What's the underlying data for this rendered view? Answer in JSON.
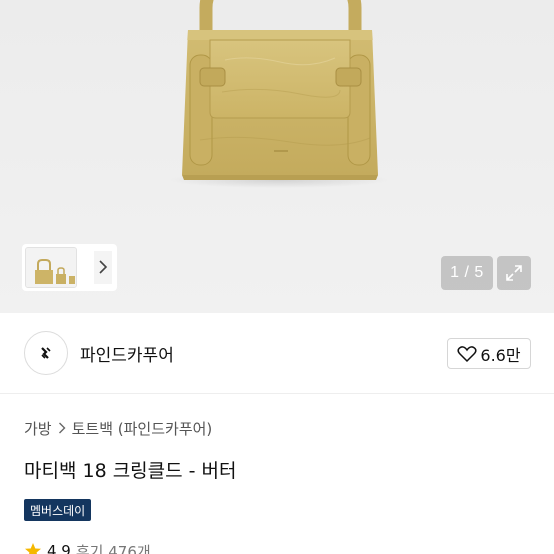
{
  "gallery": {
    "counter": "1 / 5",
    "colors": {
      "bag": "#cdb467",
      "bag_dark": "#a8904b",
      "bag_light": "#dcc885"
    }
  },
  "seller": {
    "name": "파인드카푸어",
    "like_count": "6.6만"
  },
  "breadcrumb": {
    "category": "가방",
    "subcategory": "토트백 (파인드카푸어)"
  },
  "product": {
    "title": "마티백 18 크링클드 - 버터",
    "badge": "멤버스데이",
    "badge_color": "#14365f",
    "rating": "4.9",
    "reviews": "후기 476개"
  },
  "icons": {
    "thumb_next": "chevron-right-icon",
    "expand": "expand-icon",
    "like": "heart-outline-icon",
    "breadcrumb_sep": "chevron-right-icon",
    "rating": "star-icon",
    "seller_logo": "brand-logo-icon"
  }
}
